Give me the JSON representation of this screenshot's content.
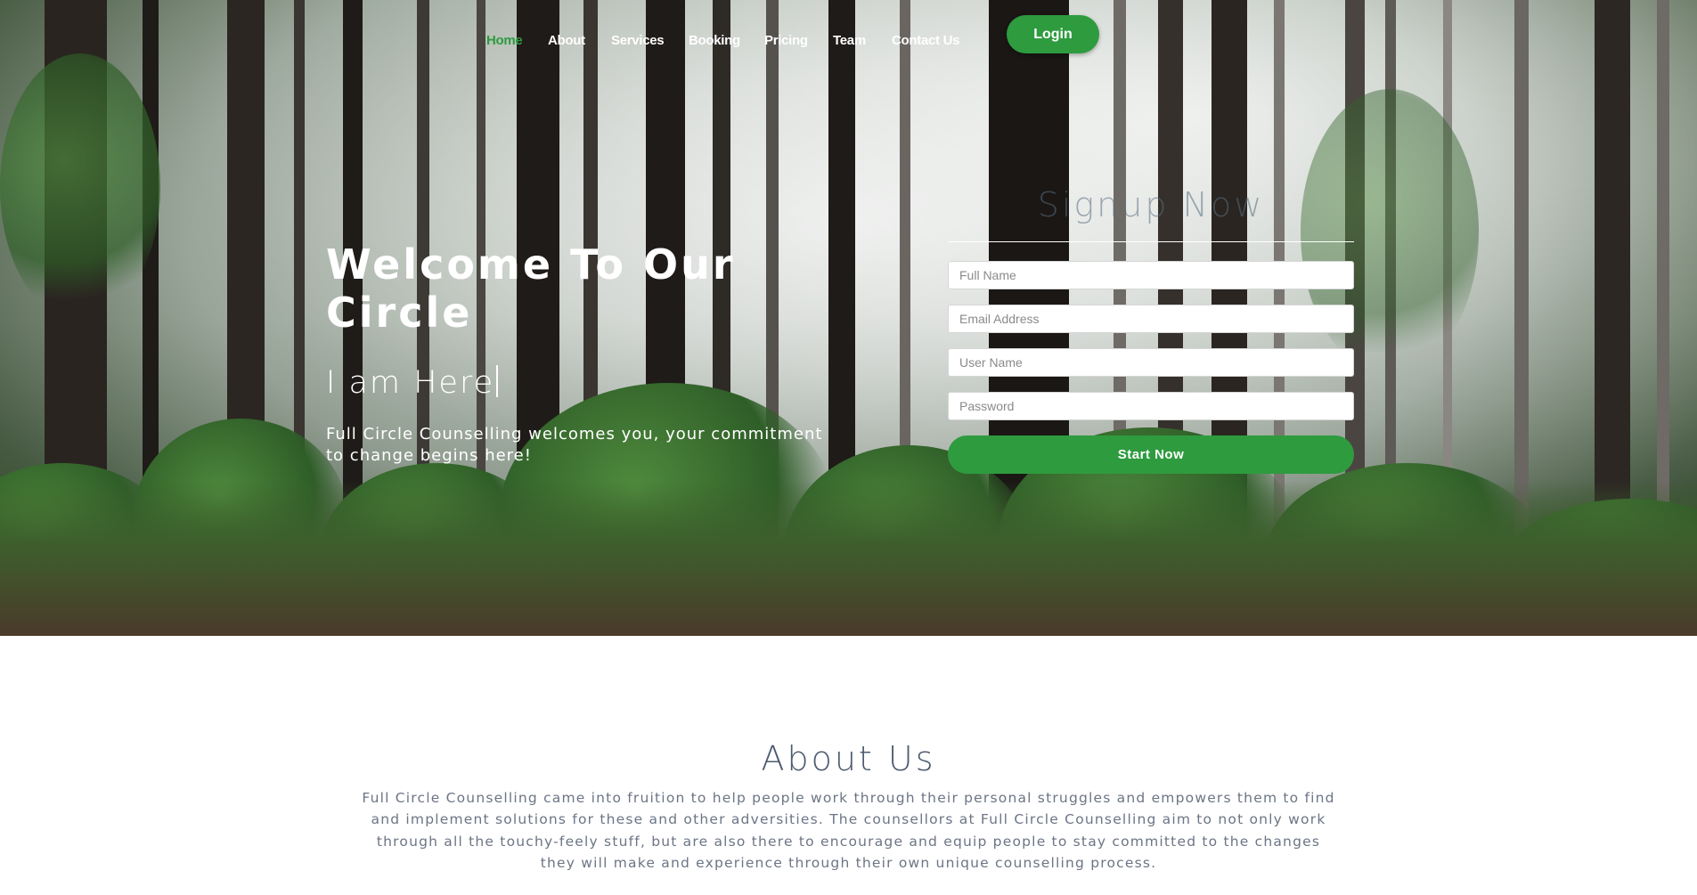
{
  "nav": {
    "items": [
      {
        "label": "Home",
        "active": true
      },
      {
        "label": "About"
      },
      {
        "label": "Services"
      },
      {
        "label": "Booking"
      },
      {
        "label": "Pricing"
      },
      {
        "label": "Team"
      },
      {
        "label": "Contact Us"
      }
    ],
    "login_label": "Login",
    "accent": "#2e9b3f"
  },
  "hero": {
    "title": "Welcome To Our Circle",
    "subtitle": "I am Here",
    "description": "Full Circle Counselling welcomes you, your commitment to change begins here!",
    "background": "forest-image"
  },
  "signup": {
    "title": "Signup Now",
    "fields": [
      {
        "placeholder": "Full Name"
      },
      {
        "placeholder": "Email Address"
      },
      {
        "placeholder": "User Name"
      },
      {
        "placeholder": "Password"
      }
    ],
    "submit_label": "Start Now"
  },
  "about": {
    "title": "About Us",
    "text": "Full Circle Counselling came into fruition to help people work through their personal struggles and empowers them to find and implement solutions for these and other adversities. The counsellors at Full Circle Counselling aim to not only work through all the touchy-feely stuff, but are also there to encourage and equip people to stay committed to the changes they will make and experience through their own unique counselling process."
  }
}
